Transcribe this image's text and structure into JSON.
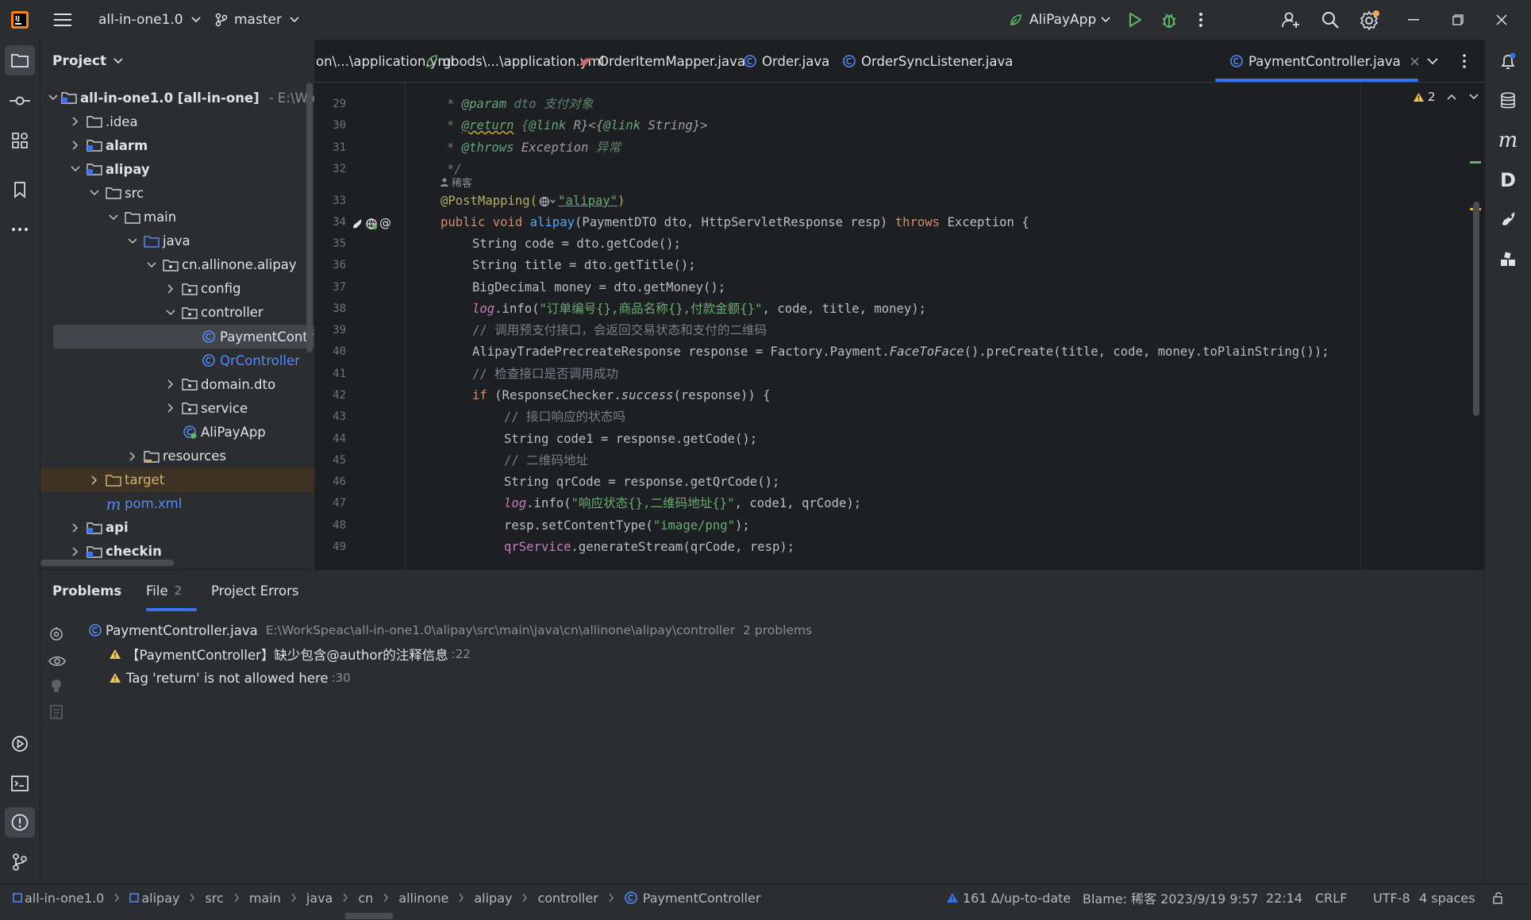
{
  "titlebar": {
    "project": "all-in-one1.0",
    "branch": "master",
    "run_config": "AliPayApp"
  },
  "project_panel": {
    "title": "Project",
    "tree": [
      {
        "label": "all-in-one1.0 [all-in-one]",
        "suffix": "- E:\\Wor",
        "depth": 0,
        "expanded": true,
        "bold": true,
        "icon": "module-folder"
      },
      {
        "label": ".idea",
        "depth": 1,
        "expanded": false,
        "icon": "folder"
      },
      {
        "label": "alarm",
        "depth": 1,
        "expanded": false,
        "bold": true,
        "icon": "module-folder"
      },
      {
        "label": "alipay",
        "depth": 1,
        "expanded": true,
        "bold": true,
        "icon": "module-folder"
      },
      {
        "label": "src",
        "depth": 2,
        "expanded": true,
        "icon": "folder"
      },
      {
        "label": "main",
        "depth": 3,
        "expanded": true,
        "icon": "folder"
      },
      {
        "label": "java",
        "depth": 4,
        "expanded": true,
        "icon": "source-folder"
      },
      {
        "label": "cn.allinone.alipay",
        "depth": 5,
        "expanded": true,
        "icon": "package"
      },
      {
        "label": "config",
        "depth": 6,
        "expanded": false,
        "icon": "package"
      },
      {
        "label": "controller",
        "depth": 6,
        "expanded": true,
        "icon": "package"
      },
      {
        "label": "PaymentContr",
        "depth": 7,
        "icon": "class",
        "selected": true
      },
      {
        "label": "QrController",
        "depth": 7,
        "icon": "class",
        "blue": true
      },
      {
        "label": "domain.dto",
        "depth": 6,
        "expanded": false,
        "icon": "package"
      },
      {
        "label": "service",
        "depth": 6,
        "expanded": false,
        "icon": "package"
      },
      {
        "label": "AliPayApp",
        "depth": 6,
        "icon": "spring-class"
      },
      {
        "label": "resources",
        "depth": 4,
        "expanded": false,
        "icon": "resources-folder"
      },
      {
        "label": "target",
        "depth": 2,
        "expanded": false,
        "icon": "excluded-folder",
        "olive": true,
        "highlight": true
      },
      {
        "label": "pom.xml",
        "depth": 2,
        "icon": "maven-file",
        "blue": true
      },
      {
        "label": "api",
        "depth": 1,
        "expanded": false,
        "bold": true,
        "icon": "module-folder"
      },
      {
        "label": "checkin",
        "depth": 1,
        "expanded": false,
        "bold": true,
        "icon": "module-folder"
      }
    ]
  },
  "tabs": [
    {
      "label": "on\\...\\application.yml",
      "icon": "none"
    },
    {
      "label": "goods\\...\\application.yml",
      "icon": "yaml-icon"
    },
    {
      "label": "OrderItemMapper.java",
      "icon": "mapper-icon"
    },
    {
      "label": "Order.java",
      "icon": "class-icon"
    },
    {
      "label": "OrderSyncListener.java",
      "icon": "class-icon"
    },
    {
      "label": "PaymentController.java",
      "icon": "class-icon",
      "active": true
    }
  ],
  "editor": {
    "warnings_count": "2",
    "author_hint": "稀客",
    "line_numbers": [
      "29",
      "30",
      "31",
      "32",
      "33",
      "34",
      "35",
      "36",
      "37",
      "38",
      "39",
      "40",
      "41",
      "42",
      "43",
      "44",
      "45",
      "46",
      "47",
      "48",
      "49"
    ]
  },
  "code": {
    "l29_tag": "@param",
    "l29_name": " dto ",
    "l29_desc": "支付对象",
    "l30_tag": "@return",
    "l30_rest1": " {",
    "l30_link1": "@link",
    "l30_rest2": " R}<{",
    "l30_link2": "@link",
    "l30_rest3": " String}>",
    "l31_tag": "@throws",
    "l31_name": " Exception ",
    "l31_desc": "异常",
    "l32": "*/",
    "l33_ann": "@PostMapping(",
    "l33_str": "\"alipay\"",
    "l33_end": ")",
    "l34_kw": "public void ",
    "l34_fn": "alipay",
    "l34_mid": "(PaymentDTO dto, HttpServletResponse resp) ",
    "l34_kw2": "throws",
    "l34_end": " Exception {",
    "l35": "String code = dto.getCode();",
    "l36": "String title = dto.getTitle();",
    "l37": "BigDecimal money = dto.getMoney();",
    "l38_log": "log",
    "l38_a": ".info(",
    "l38_str": "\"订单编号{},商品名称{},付款金额{}\"",
    "l38_b": ", code, title, money);",
    "l39": "// 调用预支付接口，会返回交易状态和支付的二维码",
    "l40_a": "AlipayTradePrecreateResponse response = Factory.Payment.",
    "l40_it": "FaceToFace",
    "l40_b": "().preCreate(title, code, money.toPlainString());",
    "l41": "// 检查接口是否调用成功",
    "l42_kw": "if",
    "l42_a": " (ResponseChecker.",
    "l42_it": "success",
    "l42_b": "(response)) {",
    "l43": "// 接口响应的状态吗",
    "l44": "String code1 = response.getCode();",
    "l45": "// 二维码地址",
    "l46": "String qrCode = response.getQrCode();",
    "l47_log": "log",
    "l47_a": ".info(",
    "l47_str": "\"响应状态{},二维码地址{}\"",
    "l47_b": ", code1, qrCode);",
    "l48_a": "resp.setContentType(",
    "l48_str": "\"image/png\"",
    "l48_b": ");",
    "l49_field": "qrService",
    "l49_b": ".generateStream(qrCode, resp);"
  },
  "problems": {
    "tabs": {
      "problems": "Problems",
      "file": "File",
      "file_count": "2",
      "project_errors": "Project Errors"
    },
    "file_name": "PaymentController.java",
    "file_path": "E:\\WorkSpeac\\all-in-one1.0\\alipay\\src\\main\\java\\cn\\allinone\\alipay\\controller",
    "file_count_text": "2 problems",
    "items": [
      {
        "text": "【PaymentController】缺少包含@author的注释信息",
        "line": ":22"
      },
      {
        "text": "Tag 'return' is not allowed here",
        "line": ":30"
      }
    ]
  },
  "statusbar": {
    "breadcrumb": [
      "all-in-one1.0",
      "alipay",
      "src",
      "main",
      "java",
      "cn",
      "allinone",
      "alipay",
      "controller",
      "PaymentController"
    ],
    "vcs": "161 Δ/up-to-date",
    "blame": "Blame: 稀客 2023/9/19 9:57",
    "position": "22:14",
    "line_sep": "CRLF",
    "encoding": "UTF-8",
    "indent": "4 spaces"
  },
  "colors": {
    "accent": "#3574f0",
    "warning": "#f2c55c",
    "run": "#5fb865"
  }
}
